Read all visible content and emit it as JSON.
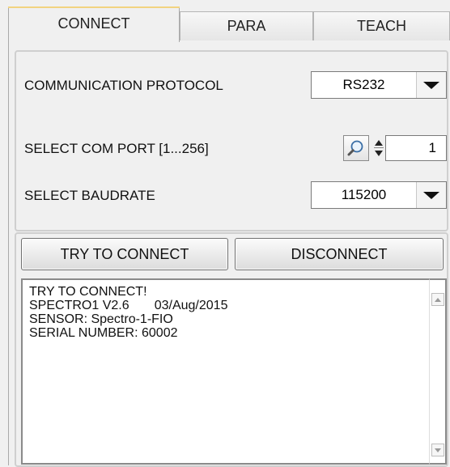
{
  "tabs": [
    {
      "label": "CONNECT"
    },
    {
      "label": "PARA"
    },
    {
      "label": "TEACH"
    }
  ],
  "connection": {
    "protocol_label": "COMMUNICATION PROTOCOL",
    "protocol_value": "RS232",
    "com_port_label": "SELECT COM PORT [1...256]",
    "com_port_value": "1",
    "baudrate_label": "SELECT BAUDRATE",
    "baudrate_value": "115200"
  },
  "buttons": {
    "connect_label": "TRY TO CONNECT",
    "disconnect_label": "DISCONNECT"
  },
  "log": {
    "lines": [
      "TRY TO CONNECT!",
      "SPECTRO1 V2.6       03/Aug/2015",
      "SENSOR: Spectro-1-FIO",
      "SERIAL NUMBER: 60002"
    ]
  },
  "icons": {
    "search": "magnifier-icon",
    "dropdown": "chevron-down-icon",
    "spinner": "up-down-arrows-icon"
  }
}
